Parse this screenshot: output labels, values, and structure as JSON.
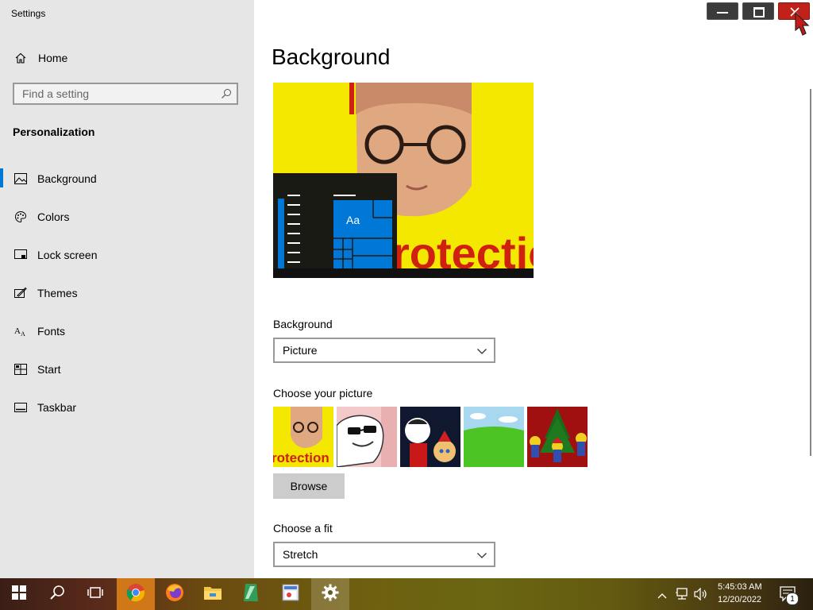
{
  "window": {
    "app_title": "Settings",
    "minimize_icon": "minimize-icon",
    "maximize_icon": "maximize-icon",
    "close_icon": "close-icon"
  },
  "sidebar": {
    "home_label": "Home",
    "search_placeholder": "Find a setting",
    "section_title": "Personalization",
    "items": [
      {
        "label": "Background",
        "icon": "picture-icon",
        "active": true
      },
      {
        "label": "Colors",
        "icon": "palette-icon"
      },
      {
        "label": "Lock screen",
        "icon": "lock-screen-icon"
      },
      {
        "label": "Themes",
        "icon": "themes-icon"
      },
      {
        "label": "Fonts",
        "icon": "fonts-icon"
      },
      {
        "label": "Start",
        "icon": "start-icon"
      },
      {
        "label": "Taskbar",
        "icon": "taskbar-icon"
      }
    ]
  },
  "main": {
    "page_title": "Background",
    "preview": {
      "sample_text": "Aa",
      "wallpaper_text": "rotection"
    },
    "background_label": "Background",
    "background_value": "Picture",
    "choose_picture_label": "Choose your picture",
    "thumb_text": "rotection",
    "browse_label": "Browse",
    "choose_fit_label": "Choose a fit",
    "fit_value": "Stretch"
  },
  "taskbar": {
    "apps": [
      "start-icon",
      "search-icon",
      "task-view-icon",
      "chrome-icon",
      "firefox-icon",
      "file-explorer-icon",
      "app-icon",
      "paint-icon",
      "settings-icon"
    ],
    "time": "5:45:03 AM",
    "date": "12/20/2022",
    "notification_count": "1"
  },
  "colors": {
    "accent": "#0078d7",
    "close": "#c0211a",
    "preview_yellow": "#f5e800"
  }
}
